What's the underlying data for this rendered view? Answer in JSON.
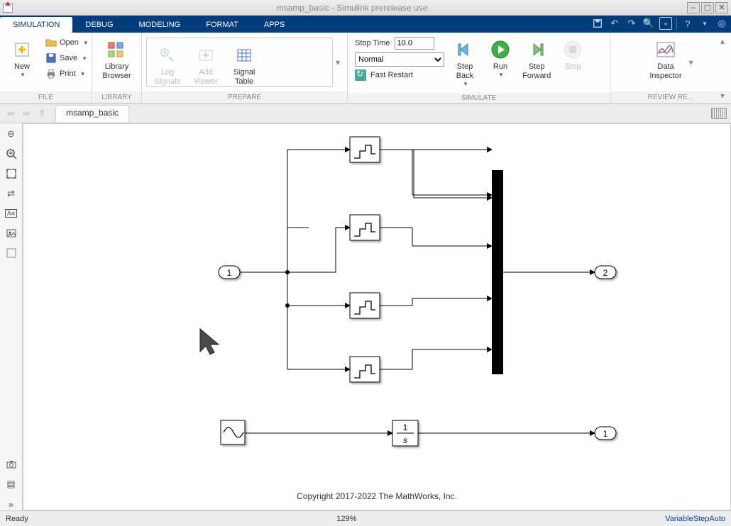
{
  "window": {
    "title": "msamp_basic - Simulink prerelease use"
  },
  "tabs": {
    "items": [
      "SIMULATION",
      "DEBUG",
      "MODELING",
      "FORMAT",
      "APPS"
    ],
    "active_index": 0
  },
  "toolstrip": {
    "file": {
      "new": "New",
      "open": "Open",
      "save": "Save",
      "print": "Print",
      "group_label": "FILE"
    },
    "library": {
      "browser": "Library\nBrowser",
      "group_label": "LIBRARY"
    },
    "prepare": {
      "log_signals": "Log\nSignals",
      "add_viewer": "Add\nViewer",
      "signal_table": "Signal\nTable",
      "group_label": "PREPARE"
    },
    "simulate": {
      "stop_time_label": "Stop Time",
      "stop_time_value": "10.0",
      "mode_selected": "Normal",
      "fast_restart": "Fast Restart",
      "step_back": "Step\nBack",
      "run": "Run",
      "step_forward": "Step\nForward",
      "stop": "Stop",
      "group_label": "SIMULATE"
    },
    "review": {
      "data_inspector": "Data\nInspector",
      "group_label": "REVIEW RE..."
    }
  },
  "breadcrumb": {
    "model_name": "msamp_basic"
  },
  "diagram": {
    "inport_label": "1",
    "outport_top_label": "2",
    "outport_bottom_label": "1",
    "integrator_num": "1",
    "integrator_den": "s",
    "copyright": "Copyright 2017-2022 The MathWorks, Inc."
  },
  "status": {
    "left": "Ready",
    "zoom": "129%",
    "solver": "VariableStepAuto"
  }
}
